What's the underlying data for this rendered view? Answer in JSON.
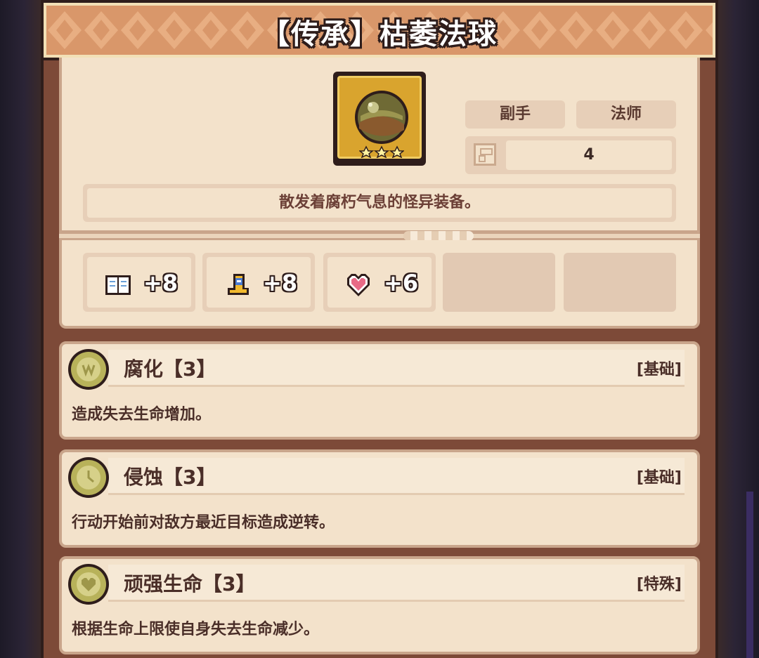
{
  "title": "【传承】枯萎法球",
  "item": {
    "icon": "withered-orb-icon",
    "stars": 3,
    "tags": [
      "副手",
      "法师"
    ],
    "slot_value": "4",
    "description": "散发着腐朽气息的怪异装备。"
  },
  "stats": [
    {
      "icon": "book-icon",
      "value": "+8"
    },
    {
      "icon": "boot-icon",
      "value": "+8"
    },
    {
      "icon": "heart-icon",
      "value": "+6"
    }
  ],
  "skills": [
    {
      "name": "腐化【3】",
      "type": "[基础]",
      "text": "造成失去生命增加。",
      "icon": "corrosion-coin-icon"
    },
    {
      "name": "侵蚀【3】",
      "type": "[基础]",
      "text": "行动开始前对敌方最近目标造成逆转。",
      "icon": "erosion-coin-icon"
    },
    {
      "name": "顽强生命【3】",
      "type": "[特殊]",
      "text": "根据生命上限使自身失去生命减少。",
      "icon": "tenacious-life-coin-icon"
    }
  ],
  "colors": {
    "banner": "#d9976a",
    "card": "#f3e2cb",
    "frame": "#7d4a38",
    "gold": "#d9a42e"
  }
}
